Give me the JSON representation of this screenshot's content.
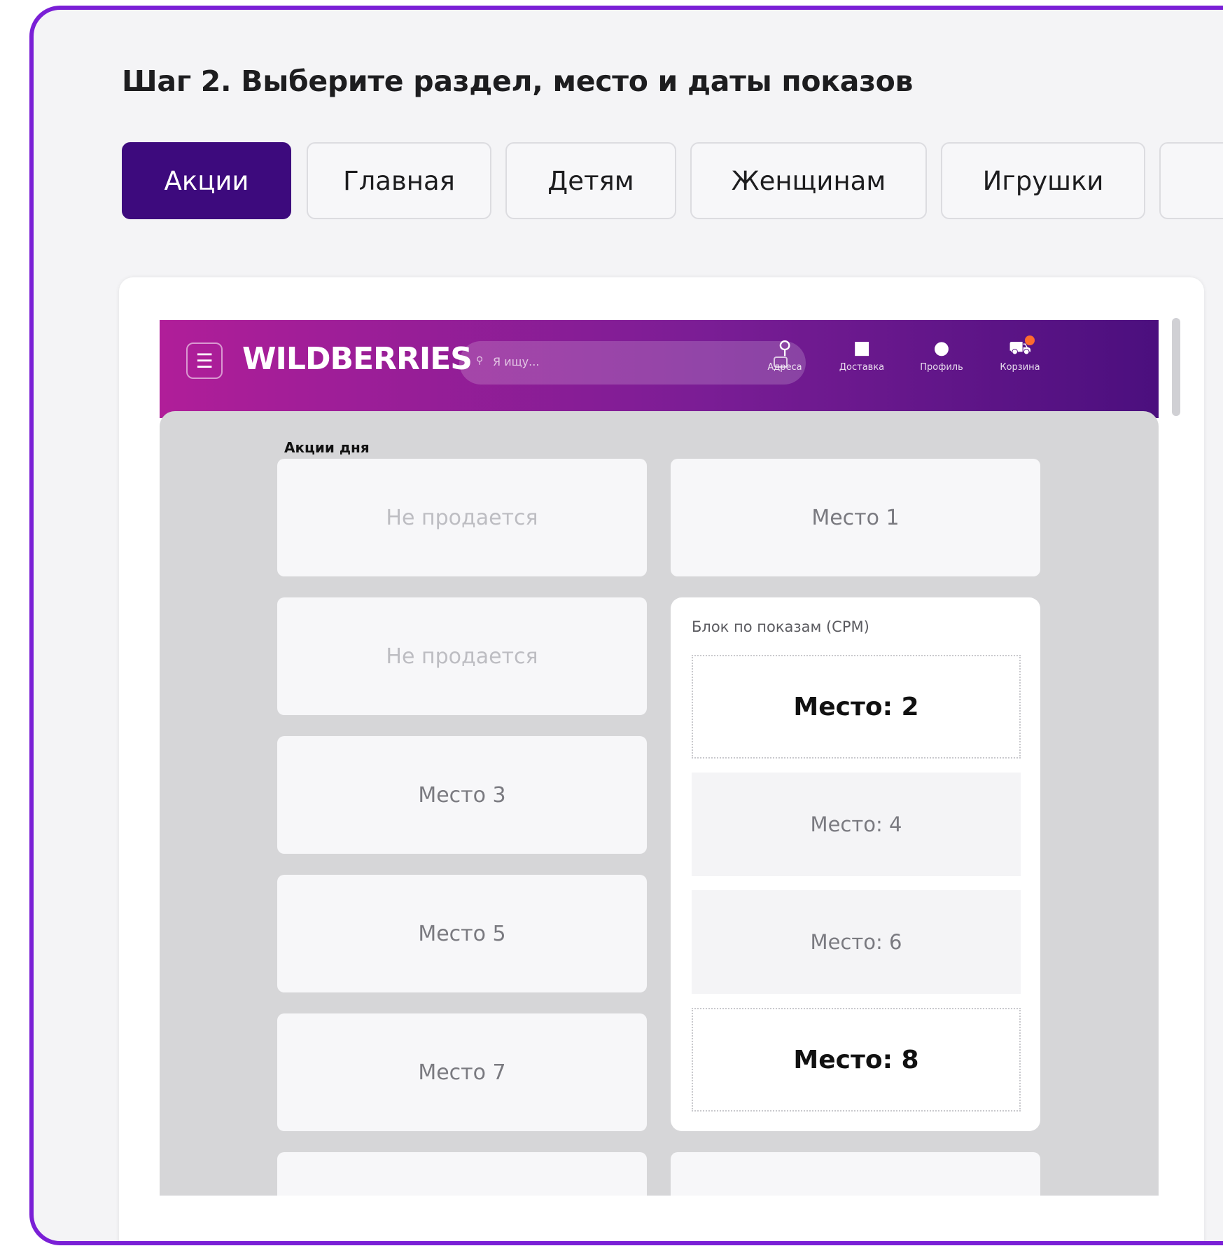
{
  "step_title": "Шаг 2. Выберите раздел, место и даты показов",
  "tabs": [
    {
      "label": "Акции",
      "active": true
    },
    {
      "label": "Главная",
      "active": false
    },
    {
      "label": "Детям",
      "active": false
    },
    {
      "label": "Женщинам",
      "active": false
    },
    {
      "label": "Игрушки",
      "active": false
    },
    {
      "label": "",
      "active": false
    }
  ],
  "wb": {
    "logo": "WILDBERRIES",
    "search_placeholder": "Я ищу...",
    "nav": [
      {
        "label": "Адреса",
        "icon": "location-pin-icon"
      },
      {
        "label": "Доставка",
        "icon": "box-icon"
      },
      {
        "label": "Профиль",
        "icon": "user-icon"
      },
      {
        "label": "Корзина",
        "icon": "cart-icon"
      }
    ],
    "section_title": "Акции дня",
    "left_cards": [
      "Не продается",
      "Не продается",
      "Место 3",
      "Место 5",
      "Место 7",
      ""
    ],
    "top_right_card": "Место 1",
    "cpm_block": {
      "label": "Блок по показам (CPM)",
      "slots": [
        "Место: 2",
        "Место: 4",
        "Место: 6",
        "Место: 8"
      ]
    },
    "bottom_right_card": ""
  },
  "colors": {
    "frame": "#7a1fd6",
    "active_tab": "#3d0a7d",
    "header_gradient_start": "#b01e99",
    "header_gradient_end": "#4b0f7e"
  }
}
